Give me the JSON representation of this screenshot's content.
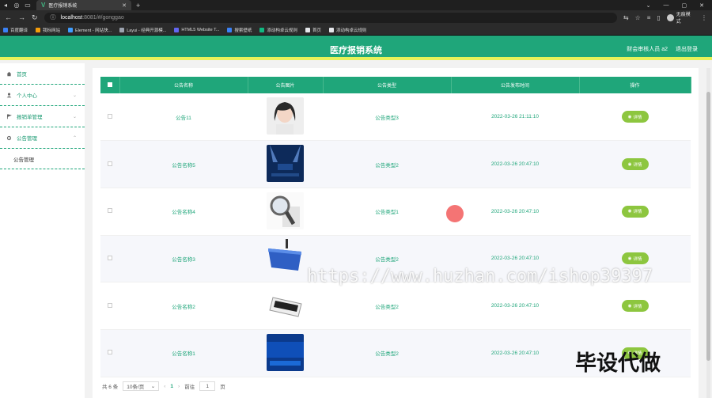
{
  "browser": {
    "tab_title": "医疗报销系统",
    "url_host": "localhost",
    "url_path": ":8081/#/gonggao",
    "profile_label": "无痕模式",
    "bookmarks": [
      "百度翻译",
      "我标网站",
      "Element - 网站快...",
      "Layui - 经典开源模...",
      "HTML5 Website T...",
      "搜索壁纸",
      "添动构卓云规则",
      "首页",
      "添动构卓云规则"
    ]
  },
  "header": {
    "title": "医疗报销系统",
    "user_label": "财会审核人员 a2",
    "logout_label": "退出登录"
  },
  "sidebar": {
    "home": "首页",
    "items": [
      {
        "label": "个人中心"
      },
      {
        "label": "报销单管理"
      },
      {
        "label": "公告管理"
      }
    ],
    "sub_item": "公告管理"
  },
  "table": {
    "columns": [
      "公告名称",
      "公告图片",
      "公告类型",
      "公告发布时间",
      "操作"
    ],
    "rows": [
      {
        "name": "公告11",
        "type": "公告类型3",
        "time": "2022-03-26 21:11:10",
        "image": "portrait"
      },
      {
        "name": "公告名称5",
        "type": "公告类型2",
        "time": "2022-03-26 20:47:10",
        "image": "news-stage"
      },
      {
        "name": "公告名称4",
        "type": "公告类型1",
        "time": "2022-03-26 20:47:10",
        "image": "magnifier"
      },
      {
        "name": "公告名称3",
        "type": "公告类型2",
        "time": "2022-03-26 20:47:10",
        "image": "news-blue"
      },
      {
        "name": "公告名称2",
        "type": "公告类型2",
        "time": "2022-03-26 20:47:10",
        "image": "news-white"
      },
      {
        "name": "公告名称1",
        "type": "公告类型2",
        "time": "2022-03-26 20:47:10",
        "image": "news-cn"
      }
    ],
    "detail_label": "详情"
  },
  "pagination": {
    "total": "共 6 条",
    "page_size": "10条/页",
    "current": "1",
    "goto_label": "前往",
    "goto_value": "1",
    "page_suffix": "页"
  },
  "overlay": {
    "watermark": "https://www.huzhan.com/ishop39397",
    "badge": "毕设代做"
  },
  "colors": {
    "primary": "#1fa67a",
    "accent_stripe": "#e7f25a",
    "detail_button": "#8dc63f"
  }
}
